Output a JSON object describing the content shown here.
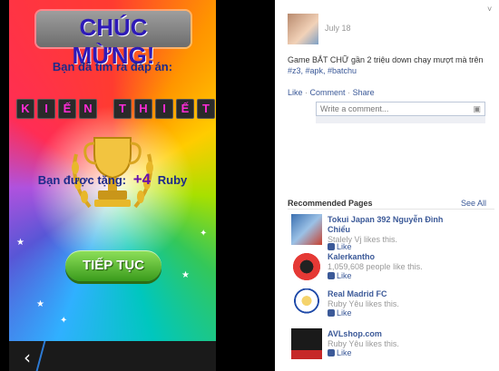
{
  "game": {
    "title": "CHÚC MỪNG!",
    "subtitle": "Bạn đã tìm ra đáp án:",
    "answer_letters": [
      "K",
      "I",
      "Ế",
      "N",
      "T",
      "H",
      "I",
      "Ế",
      "T"
    ],
    "gift_prefix": "Bạn được tặng:",
    "gift_amount": "+4",
    "gift_unit": "Ruby",
    "continue_label": "TIẾP TỤC"
  },
  "navbar": {
    "back_glyph": "‹"
  },
  "post": {
    "date": "July 18",
    "text": "Game BẮT CHỮ gần 2 triệu down chạy mượt mà trên",
    "tags": "#z3, #apk, #batchu",
    "actions": [
      "Like",
      "Comment",
      "Share"
    ],
    "comment_placeholder": "Write a comment..."
  },
  "recommended": {
    "title": "Recommended Pages",
    "see_all": "See All",
    "items": [
      {
        "name": "Tokui Japan 392 Nguyễn Đình Chiểu",
        "meta": "Stalely Vj likes this.",
        "like": "Like"
      },
      {
        "name": "Kalerkantho",
        "meta": "1,059,608 people like this.",
        "like": "Like"
      },
      {
        "name": "Real Madrid FC",
        "meta": "Ruby Yêu likes this.",
        "like": "Like"
      },
      {
        "name": "AVLshop.com",
        "meta": "Ruby Yêu likes this.",
        "like": "Like"
      }
    ]
  },
  "colors": {
    "fb_link": "#3b5998",
    "title_text": "#2e1ab8",
    "tile_letter": "#ff2bd6",
    "button_green": "#3a9b1c"
  }
}
